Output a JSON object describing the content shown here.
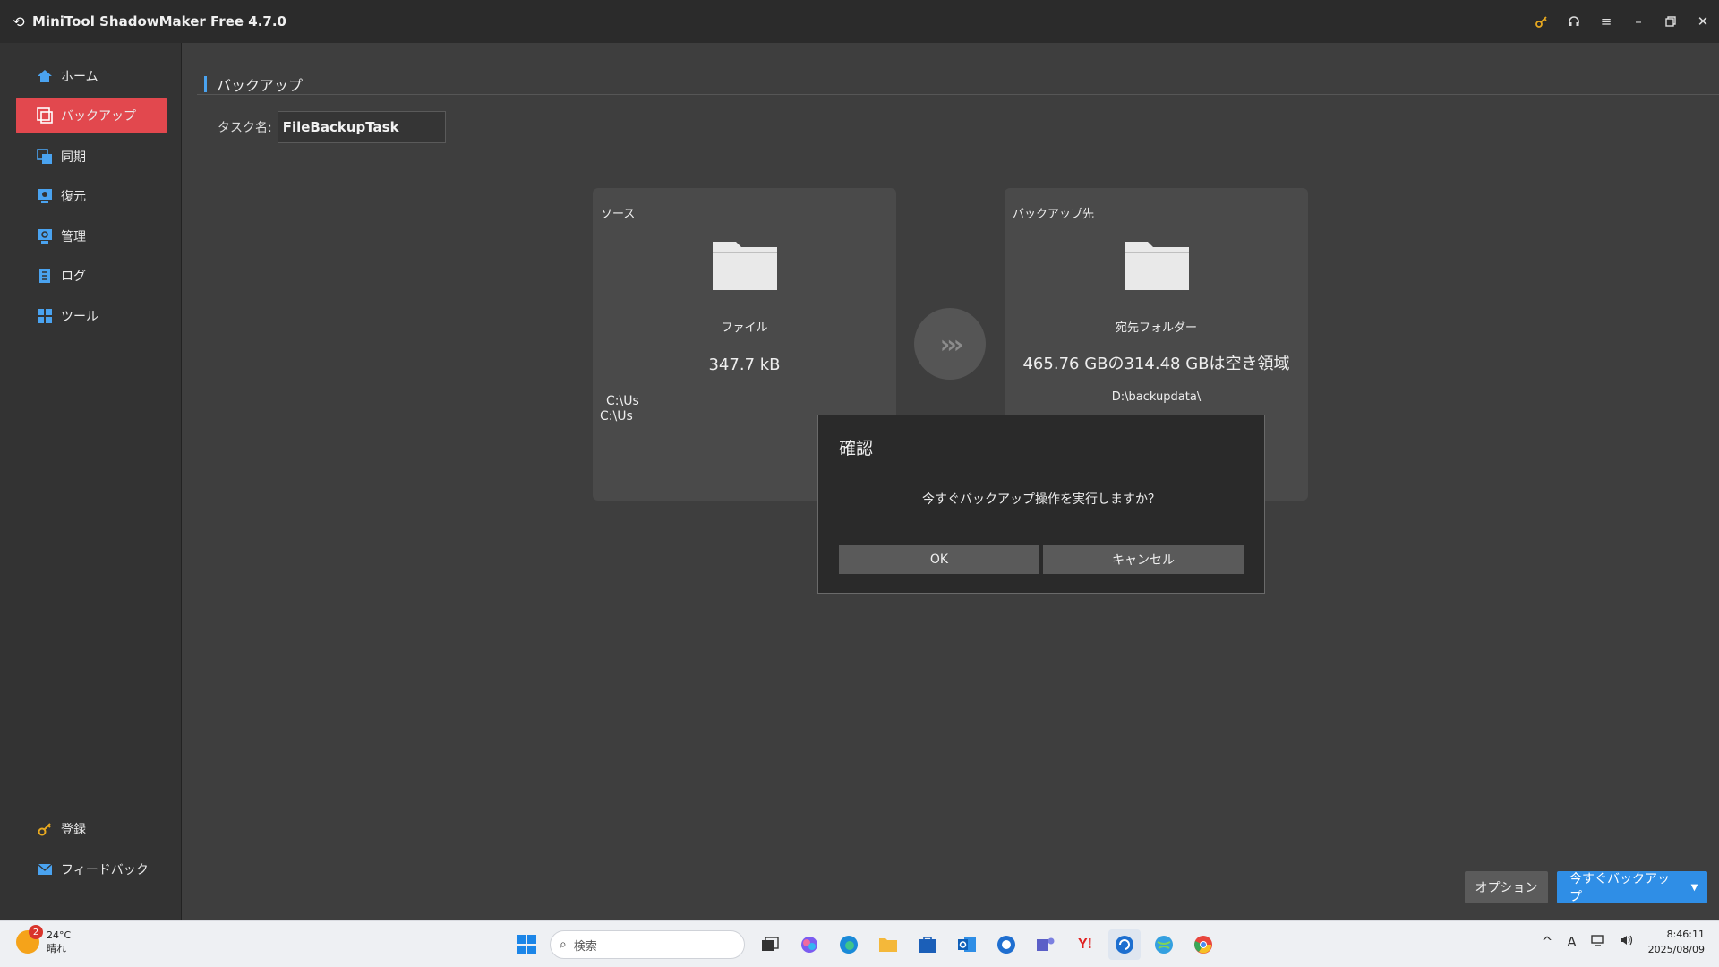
{
  "app": {
    "title": "MiniTool ShadowMaker Free 4.7.0",
    "window_controls": [
      "key-icon",
      "headset-icon",
      "menu-icon",
      "minimize-icon",
      "restore-icon",
      "close-icon"
    ]
  },
  "sidebar": {
    "items": [
      {
        "label": "ホーム",
        "icon": "home-icon",
        "active": false
      },
      {
        "label": "バックアップ",
        "icon": "backup-icon",
        "active": true
      },
      {
        "label": "同期",
        "icon": "sync-icon",
        "active": false
      },
      {
        "label": "復元",
        "icon": "restore-icon",
        "active": false
      },
      {
        "label": "管理",
        "icon": "manage-icon",
        "active": false
      },
      {
        "label": "ログ",
        "icon": "log-icon",
        "active": false
      },
      {
        "label": "ツール",
        "icon": "tools-icon",
        "active": false
      }
    ],
    "bottom_items": [
      {
        "label": "登録",
        "icon": "key-icon"
      },
      {
        "label": "フィードバック",
        "icon": "mail-icon"
      }
    ]
  },
  "main": {
    "heading": "バックアップ",
    "task_name_label": "タスク名:",
    "task_name_value": "FileBackupTask",
    "source": {
      "title": "ソース",
      "type": "ファイル",
      "size": "347.7 kB",
      "paths": [
        "C:\\Us",
        "C:\\Us"
      ]
    },
    "destination": {
      "title": "バックアップ先",
      "type": "宛先フォルダー",
      "space": "465.76 GBの314.48 GBは空き領域",
      "path": "D:\\backupdata\\"
    },
    "options_button": "オプション",
    "backup_now_button": "今すぐバックアップ"
  },
  "dialog": {
    "title": "確認",
    "message": "今すぐバックアップ操作を実行しますか？",
    "ok": "OK",
    "cancel": "キャンセル"
  },
  "taskbar": {
    "weather_temp": "24°C",
    "weather_desc": "晴れ",
    "weather_badge": "2",
    "search_placeholder": "検索",
    "time": "8:46:11",
    "date": "2025/08/09",
    "ime": "A"
  },
  "colors": {
    "accent_red": "#e2484e",
    "accent_blue": "#2f8ee6",
    "icon_blue": "#4aa3f0"
  }
}
